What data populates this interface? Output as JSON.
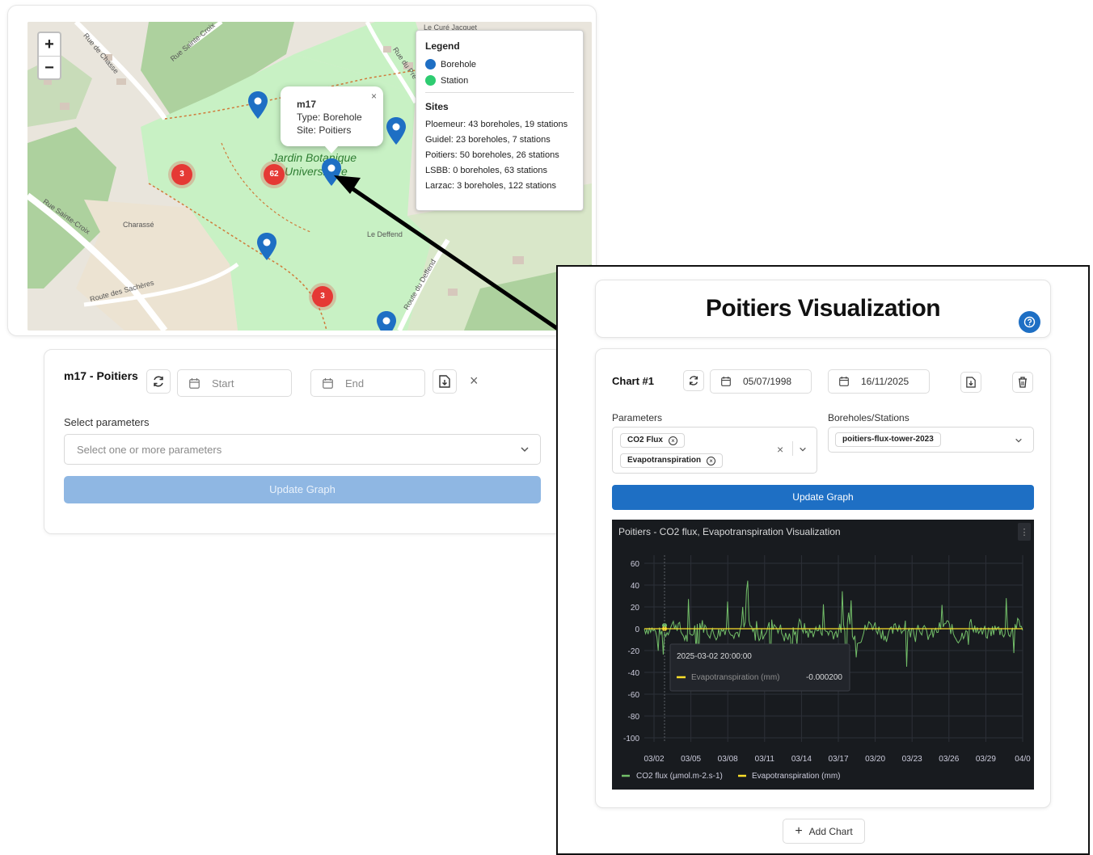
{
  "map": {
    "zoom_in": "+",
    "zoom_out": "−",
    "labels": [
      "Le Curé Jacquet",
      "Charassé",
      "Le Deffend",
      "Rue Sainte-Croix",
      "Route des Sachères",
      "Route du Deffend",
      "Rue du Pré des Moines",
      "Rue de Chasse",
      "Rue Sainte-Croix"
    ],
    "garden_label_1": "Jardin Botanique",
    "garden_label_2": "Universitaire",
    "clusters": [
      {
        "count": "3"
      },
      {
        "count": "62"
      },
      {
        "count": "3"
      }
    ],
    "popup": {
      "close": "×",
      "title": "m17",
      "type_line": "Type: Borehole",
      "site_line": "Site: Poitiers"
    },
    "legend": {
      "title": "Legend",
      "items": [
        {
          "label": "Borehole",
          "color": "#1e6fc4"
        },
        {
          "label": "Station",
          "color": "#2ecc71"
        }
      ],
      "sites_title": "Sites",
      "sites": [
        "Ploemeur: 43 boreholes, 19 stations",
        "Guidel: 23 boreholes, 7 stations",
        "Poitiers: 50 boreholes, 26 stations",
        "LSBB: 0 boreholes, 63 stations",
        "Larzac: 3 boreholes, 122 stations"
      ]
    }
  },
  "form": {
    "title": "m17 - Poitiers",
    "start_placeholder": "Start",
    "end_placeholder": "End",
    "close": "×",
    "params_label": "Select parameters",
    "params_placeholder": "Select one or more parameters",
    "update_label": "Update Graph"
  },
  "zoom_panel": {
    "page_title": "Poitiers Visualization",
    "chart": {
      "title": "Chart #1",
      "start_date": "05/07/1998",
      "end_date": "16/11/2025",
      "params_label": "Parameters",
      "params": [
        "CO2 Flux",
        "Evapotranspiration"
      ],
      "stations_label": "Boreholes/Stations",
      "station": "poitiers-flux-tower-2023",
      "update_label": "Update Graph",
      "add_chart_label": "Add Chart"
    }
  },
  "chart_data": {
    "type": "line",
    "title": "Poitiers - CO2 flux, Evapotranspiration Visualization",
    "x_ticks": [
      "03/02",
      "03/05",
      "03/08",
      "03/11",
      "03/14",
      "03/17",
      "03/20",
      "03/23",
      "03/26",
      "03/29",
      "04/0"
    ],
    "y_ticks": [
      "60",
      "40",
      "20",
      "0",
      "-20",
      "-40",
      "-60",
      "-80",
      "-100"
    ],
    "ylim": [
      -100,
      60
    ],
    "series": [
      {
        "name": "CO2 flux (µmol.m-2.s-1)",
        "color": "#73bf69"
      },
      {
        "name": "Evapotranspiration (mm)",
        "color": "#fade2a"
      }
    ],
    "tooltip": {
      "time": "2025-03-02 20:00:00",
      "series": "Evapotranspiration (mm)",
      "value": "-0.000200"
    },
    "grid": true,
    "legend_position": "bottom-left"
  }
}
